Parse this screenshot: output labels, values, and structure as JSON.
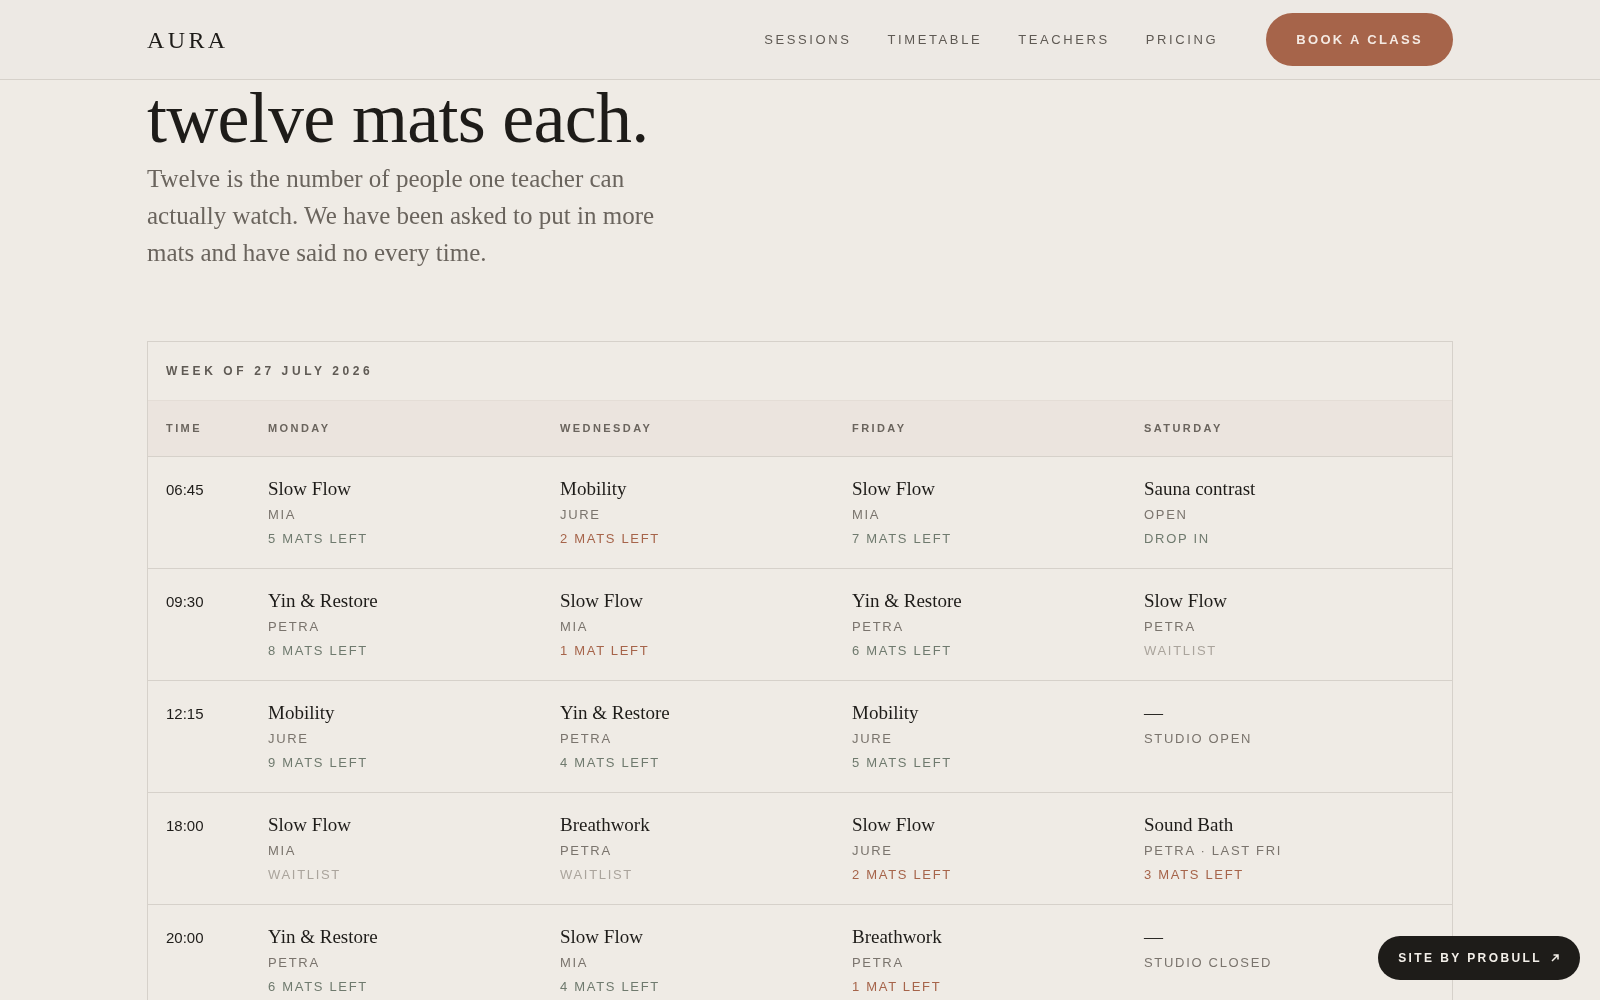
{
  "nav": {
    "logo": "AURA",
    "links": [
      "SESSIONS",
      "TIMETABLE",
      "TEACHERS",
      "PRICING"
    ],
    "cta": "BOOK A CLASS"
  },
  "hero": {
    "heading": "twelve mats each.",
    "intro": "Twelve is the number of people one teacher can actually watch. We have been asked to put in more mats and have said no every time."
  },
  "timetable": {
    "week": "WEEK OF 27 JULY 2026",
    "columns": [
      "TIME",
      "MONDAY",
      "WEDNESDAY",
      "FRIDAY",
      "SATURDAY"
    ],
    "rows": [
      {
        "cells": [
          {
            "kind": "time",
            "title": "06:45"
          },
          {
            "kind": "session",
            "title": "Slow Flow",
            "sub": "MIA",
            "status": {
              "text": "5 MATS LEFT",
              "kind": "open"
            }
          },
          {
            "kind": "session",
            "title": "Mobility",
            "sub": "JURE",
            "status": {
              "text": "2 MATS LEFT",
              "kind": "low"
            }
          },
          {
            "kind": "session",
            "title": "Slow Flow",
            "sub": "MIA",
            "status": {
              "text": "7 MATS LEFT",
              "kind": "open"
            }
          },
          {
            "kind": "session",
            "title": "Sauna contrast",
            "sub": "OPEN",
            "status": {
              "text": "DROP IN",
              "kind": "open"
            }
          }
        ]
      },
      {
        "cells": [
          {
            "kind": "time",
            "title": "09:30"
          },
          {
            "kind": "session",
            "title": "Yin & Restore",
            "sub": "PETRA",
            "status": {
              "text": "8 MATS LEFT",
              "kind": "open"
            }
          },
          {
            "kind": "session",
            "title": "Slow Flow",
            "sub": "MIA",
            "status": {
              "text": "1 MAT LEFT",
              "kind": "low"
            }
          },
          {
            "kind": "session",
            "title": "Yin & Restore",
            "sub": "PETRA",
            "status": {
              "text": "6 MATS LEFT",
              "kind": "open"
            }
          },
          {
            "kind": "session",
            "title": "Slow Flow",
            "sub": "PETRA",
            "status": {
              "text": "WAITLIST",
              "kind": "waitlist"
            }
          }
        ]
      },
      {
        "cells": [
          {
            "kind": "time",
            "title": "12:15"
          },
          {
            "kind": "session",
            "title": "Mobility",
            "sub": "JURE",
            "status": {
              "text": "9 MATS LEFT",
              "kind": "open"
            }
          },
          {
            "kind": "session",
            "title": "Yin & Restore",
            "sub": "PETRA",
            "status": {
              "text": "4 MATS LEFT",
              "kind": "open"
            }
          },
          {
            "kind": "session",
            "title": "Mobility",
            "sub": "JURE",
            "status": {
              "text": "5 MATS LEFT",
              "kind": "open"
            }
          },
          {
            "kind": "session",
            "title": "—",
            "sub": "STUDIO OPEN"
          }
        ]
      },
      {
        "cells": [
          {
            "kind": "time",
            "title": "18:00"
          },
          {
            "kind": "session",
            "title": "Slow Flow",
            "sub": "MIA",
            "status": {
              "text": "WAITLIST",
              "kind": "waitlist"
            }
          },
          {
            "kind": "session",
            "title": "Breathwork",
            "sub": "PETRA",
            "status": {
              "text": "WAITLIST",
              "kind": "waitlist"
            }
          },
          {
            "kind": "session",
            "title": "Slow Flow",
            "sub": "JURE",
            "status": {
              "text": "2 MATS LEFT",
              "kind": "low"
            }
          },
          {
            "kind": "session",
            "title": "Sound Bath",
            "sub": "PETRA · LAST FRI",
            "status": {
              "text": "3 MATS LEFT",
              "kind": "low"
            }
          }
        ]
      },
      {
        "cells": [
          {
            "kind": "time",
            "title": "20:00"
          },
          {
            "kind": "session",
            "title": "Yin & Restore",
            "sub": "PETRA",
            "status": {
              "text": "6 MATS LEFT",
              "kind": "open"
            }
          },
          {
            "kind": "session",
            "title": "Slow Flow",
            "sub": "MIA",
            "status": {
              "text": "4 MATS LEFT",
              "kind": "open"
            }
          },
          {
            "kind": "session",
            "title": "Breathwork",
            "sub": "PETRA",
            "status": {
              "text": "1 MAT LEFT",
              "kind": "low"
            }
          },
          {
            "kind": "session",
            "title": "—",
            "sub": "STUDIO CLOSED"
          }
        ]
      }
    ]
  },
  "credit": "SITE BY PROBULL"
}
